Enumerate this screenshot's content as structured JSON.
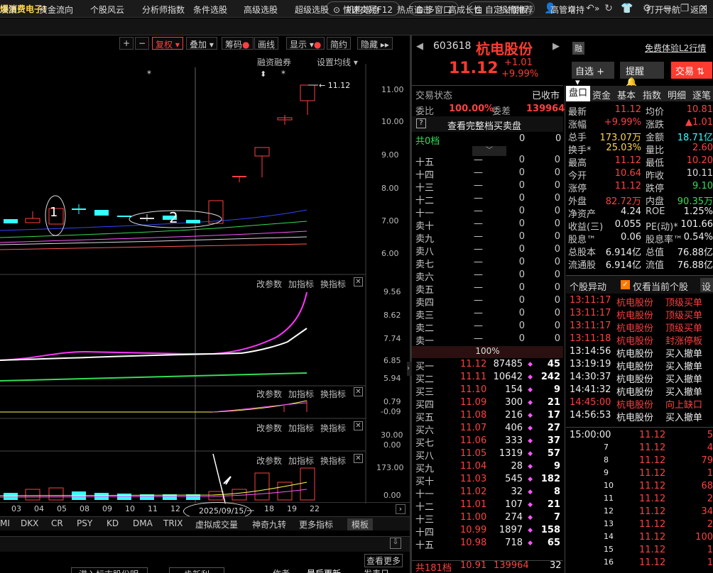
{
  "titlebar": {
    "news": "爆消费电子!",
    "fast_trade": "快速交易F12",
    "multi_window": "多窗口",
    "custom_panel": "自定义面板"
  },
  "menu": [
    "决策",
    "资金流向",
    "个股风云",
    "分析师指数",
    "条件选股",
    "高级选股",
    "超级选股",
    "机构增仓",
    "热点追击",
    "高成长性",
    "机构推荐",
    "高管增持",
    "打开导航",
    "返回"
  ],
  "toolbar": {
    "fuquan": "复权",
    "diejia": "叠加",
    "chouma": "筹码",
    "huaxian": "画线",
    "xianshi": "显示",
    "jianyue": "简约",
    "yincang": "隐藏",
    "rongzi": "融资融券",
    "junxian": "设置均线"
  },
  "price_axis": [
    "11.00",
    "10.00",
    "9.00",
    "8.00",
    "7.00",
    "6.00"
  ],
  "annotations": {
    "high_price": "11.12",
    "circle1": "1",
    "circle2": "2",
    "date_box": "2025/09/15/一"
  },
  "panels": [
    {
      "buttons": [
        "改参数",
        "加指标",
        "换指标"
      ],
      "axis": [
        "9.56",
        "8.62",
        "7.74",
        "6.85",
        "5.94"
      ]
    },
    {
      "buttons": [
        "改参数",
        "加指标",
        "换指标"
      ],
      "axis": [
        "0.79",
        "-0.09"
      ]
    },
    {
      "buttons": [
        "改参数",
        "加指标",
        "换指标"
      ],
      "axis": [
        "30.00",
        "0.00"
      ]
    },
    {
      "buttons": [
        "改参数",
        "加指标",
        "换指标"
      ],
      "axis": [
        "173.00",
        "0.00"
      ]
    }
  ],
  "x_labels": [
    "03",
    "04",
    "05",
    "08",
    "09",
    "10",
    "11",
    "12",
    "18",
    "19",
    "22"
  ],
  "ind_tabs": [
    "MI",
    "DKX",
    "CR",
    "PSY",
    "KD",
    "DMA",
    "TRIX",
    "虚拟成交量",
    "神奇九转",
    "更多指标",
    "模板"
  ],
  "bottom": {
    "more": "查看更多",
    "a": "港入标志股份明",
    "b": "步新利",
    "c": "作者",
    "d": "最后更新",
    "e": "发表日"
  },
  "stock": {
    "code": "603618",
    "name": "杭电股份",
    "price": "11.12",
    "change": "+1.01",
    "pct": "+9.99%",
    "rong": "融",
    "l2": "免费体验L2行情",
    "zixuan": "自选",
    "tixing": "提醒",
    "jiaoyi": "交易"
  },
  "status": {
    "label": "交易状态",
    "value": "已收市",
    "weibi_l": "委比",
    "weibi": "100.00%",
    "weicha_l": "委差",
    "weicha": "139964",
    "full_book": "查看完整档买卖盘",
    "gong0": "共0档",
    "gong0_a": "0",
    "gong0_b": "0",
    "pct100": "100%"
  },
  "asks": [
    {
      "n": "十五",
      "p": "—",
      "v": "0",
      "c": "0"
    },
    {
      "n": "十四",
      "p": "—",
      "v": "0",
      "c": "0"
    },
    {
      "n": "十三",
      "p": "—",
      "v": "0",
      "c": "0"
    },
    {
      "n": "十二",
      "p": "—",
      "v": "0",
      "c": "0"
    },
    {
      "n": "十一",
      "p": "—",
      "v": "0",
      "c": "0"
    },
    {
      "n": "卖十",
      "p": "—",
      "v": "0",
      "c": "0"
    },
    {
      "n": "卖九",
      "p": "—",
      "v": "0",
      "c": "0"
    },
    {
      "n": "卖八",
      "p": "—",
      "v": "0",
      "c": "0"
    },
    {
      "n": "卖七",
      "p": "—",
      "v": "0",
      "c": "0"
    },
    {
      "n": "卖六",
      "p": "—",
      "v": "0",
      "c": "0"
    },
    {
      "n": "卖五",
      "p": "—",
      "v": "0",
      "c": "0"
    },
    {
      "n": "卖四",
      "p": "—",
      "v": "0",
      "c": "0"
    },
    {
      "n": "卖三",
      "p": "—",
      "v": "0",
      "c": "0"
    },
    {
      "n": "卖二",
      "p": "—",
      "v": "0",
      "c": "0"
    },
    {
      "n": "卖一",
      "p": "—",
      "v": "0",
      "c": "0"
    }
  ],
  "bids": [
    {
      "n": "买一",
      "p": "11.12",
      "v": "87485",
      "c": "45"
    },
    {
      "n": "买二",
      "p": "11.11",
      "v": "10642",
      "c": "242"
    },
    {
      "n": "买三",
      "p": "11.10",
      "v": "154",
      "c": "9"
    },
    {
      "n": "买四",
      "p": "11.09",
      "v": "300",
      "c": "21"
    },
    {
      "n": "买五",
      "p": "11.08",
      "v": "216",
      "c": "17"
    },
    {
      "n": "买六",
      "p": "11.07",
      "v": "406",
      "c": "27"
    },
    {
      "n": "买七",
      "p": "11.06",
      "v": "333",
      "c": "37"
    },
    {
      "n": "买八",
      "p": "11.05",
      "v": "1319",
      "c": "57"
    },
    {
      "n": "买九",
      "p": "11.04",
      "v": "28",
      "c": "9"
    },
    {
      "n": "买十",
      "p": "11.03",
      "v": "545",
      "c": "182"
    },
    {
      "n": "十一",
      "p": "11.02",
      "v": "32",
      "c": "8"
    },
    {
      "n": "十二",
      "p": "11.01",
      "v": "107",
      "c": "21"
    },
    {
      "n": "十三",
      "p": "11.00",
      "v": "274",
      "c": "7"
    },
    {
      "n": "十四",
      "p": "10.99",
      "v": "1897",
      "c": "158"
    },
    {
      "n": "十五",
      "p": "10.98",
      "v": "718",
      "c": "65"
    }
  ],
  "gong181": {
    "l": "共181档",
    "p": "10.91",
    "v": "139964",
    "c": "32"
  },
  "qtabs": [
    "盘口",
    "资金",
    "基本",
    "指数",
    "明细",
    "逐笔"
  ],
  "quote": [
    [
      "最新",
      "11.12",
      "均价",
      "10.81"
    ],
    [
      "涨幅",
      "+9.99%",
      "涨跌",
      "▲1.01"
    ],
    [
      "总手",
      "173.07万",
      "金额",
      "18.71亿"
    ],
    [
      "换手*",
      "25.03%",
      "量比",
      "2.60"
    ],
    [
      "最高",
      "11.12",
      "最低",
      "10.20"
    ],
    [
      "今开",
      "10.64",
      "昨收",
      "10.11"
    ],
    [
      "涨停",
      "11.12",
      "跌停",
      "9.10"
    ],
    [
      "外盘",
      "82.72万",
      "内盘",
      "90.35万"
    ],
    [
      "净资产",
      "4.24",
      "ROE",
      "1.25%"
    ],
    [
      "收益(三)",
      "0.055",
      "PE(动)*",
      "101.66"
    ],
    [
      "股息™",
      "0.06",
      "股息率™",
      "0.54%"
    ],
    [
      "总股本",
      "6.914亿",
      "总值",
      "76.88亿"
    ],
    [
      "流通股",
      "6.914亿",
      "流值",
      "76.88亿"
    ]
  ],
  "moves_hdr": {
    "title": "个股异动",
    "only": "仅看当前个股",
    "set": "设"
  },
  "moves": [
    {
      "t": "13:11:17",
      "n": "杭电股份",
      "e": "顶级买单",
      "c": "red"
    },
    {
      "t": "13:11:17",
      "n": "杭电股份",
      "e": "顶级买单",
      "c": "red"
    },
    {
      "t": "13:11:17",
      "n": "杭电股份",
      "e": "顶级买单",
      "c": "red"
    },
    {
      "t": "13:11:18",
      "n": "杭电股份",
      "e": "封涨停板",
      "c": "red"
    },
    {
      "t": "13:14:56",
      "n": "杭电股份",
      "e": "买入撤单",
      "c": "white"
    },
    {
      "t": "13:19:19",
      "n": "杭电股份",
      "e": "买入撤单",
      "c": "white"
    },
    {
      "t": "14:30:37",
      "n": "杭电股份",
      "e": "买入撤单",
      "c": "white"
    },
    {
      "t": "14:41:32",
      "n": "杭电股份",
      "e": "买入撤单",
      "c": "white"
    },
    {
      "t": "14:45:00",
      "n": "杭电股份",
      "e": "向上缺口",
      "c": "red"
    },
    {
      "t": "14:56:53",
      "n": "杭电股份",
      "e": "买入撤单",
      "c": "white"
    }
  ],
  "ticks": [
    {
      "t": "15:00:00",
      "p": "11.12",
      "v": "5"
    },
    {
      "t": "7",
      "p": "11.12",
      "v": "4"
    },
    {
      "t": "8",
      "p": "11.12",
      "v": "79"
    },
    {
      "t": "9",
      "p": "11.12",
      "v": "1"
    },
    {
      "t": "10",
      "p": "11.12",
      "v": "68"
    },
    {
      "t": "11",
      "p": "11.12",
      "v": "2"
    },
    {
      "t": "12",
      "p": "11.12",
      "v": "34"
    },
    {
      "t": "13",
      "p": "11.12",
      "v": "2"
    },
    {
      "t": "14",
      "p": "11.12",
      "v": "100"
    },
    {
      "t": "15",
      "p": "11.12",
      "v": "1"
    },
    {
      "t": "16",
      "p": "11.12",
      "v": "1"
    }
  ],
  "colors": {
    "up": "#ff4040",
    "down": "#33ffff",
    "bg": "#000000",
    "accent": "#ff3b30",
    "ma_white": "#ffffff",
    "ma_yellow": "#ffff55",
    "ma_magenta": "#ff55ff",
    "ma_green": "#33dd55"
  }
}
